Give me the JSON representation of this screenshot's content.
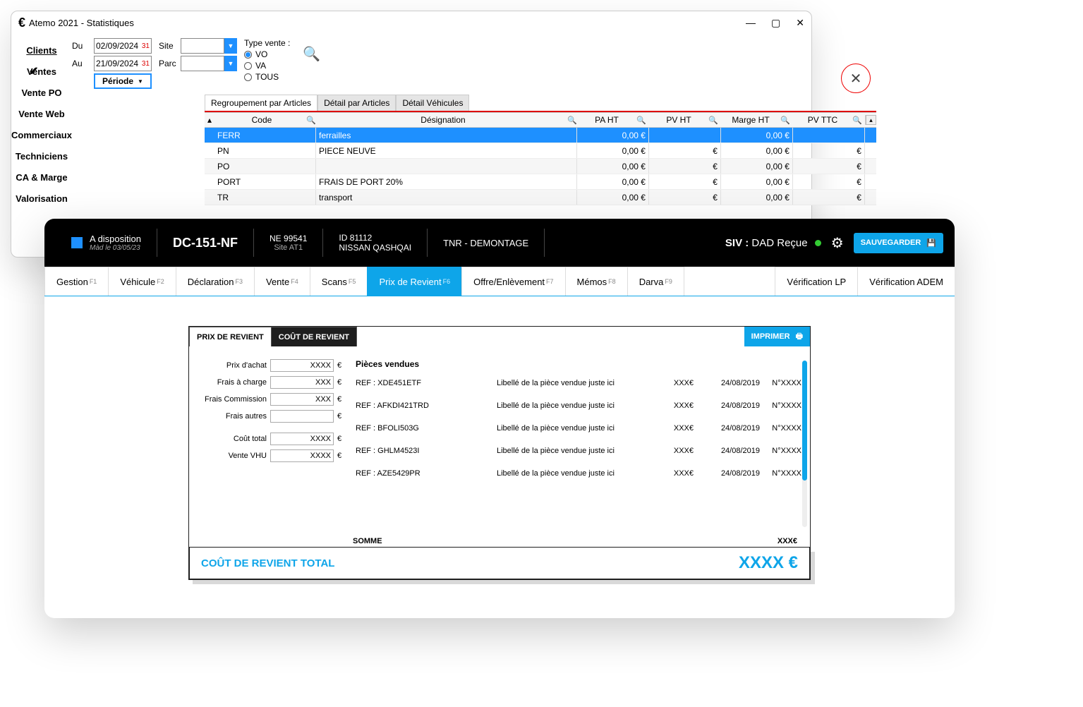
{
  "win1": {
    "title": "Atemo 2021 - Statistiques",
    "sidebar": [
      "Clients",
      "Ventes",
      "Vente PO",
      "Vente Web",
      "Commerciaux",
      "Techniciens",
      "CA & Marge",
      "Valorisation"
    ],
    "filters": {
      "du_label": "Du",
      "du_value": "02/09/2024",
      "au_label": "Au",
      "au_value": "21/09/2024",
      "period_label": "Période",
      "site_label": "Site",
      "parc_label": "Parc",
      "type_vente_label": "Type vente :",
      "radios": [
        "VO",
        "VA",
        "TOUS"
      ]
    },
    "tabs": [
      "Regroupement par Articles",
      "Détail par Articles",
      "Détail Véhicules"
    ],
    "columns": [
      "Code",
      "Désignation",
      "PA HT",
      "PV HT",
      "Marge HT",
      "PV TTC"
    ],
    "rows": [
      {
        "code": "FERR",
        "des": "ferrailles",
        "pa": "0,00 €",
        "pv": "",
        "marge": "0,00 €",
        "ttc": ""
      },
      {
        "code": "PN",
        "des": "PIECE NEUVE",
        "pa": "0,00 €",
        "pv": "€",
        "marge": "0,00 €",
        "ttc": "€"
      },
      {
        "code": "PO",
        "des": "",
        "pa": "0,00 €",
        "pv": "€",
        "marge": "0,00 €",
        "ttc": "€"
      },
      {
        "code": "PORT",
        "des": "FRAIS DE PORT 20%",
        "pa": "0,00 €",
        "pv": "€",
        "marge": "0,00 €",
        "ttc": "€"
      },
      {
        "code": "TR",
        "des": "transport",
        "pa": "0,00 €",
        "pv": "€",
        "marge": "0,00 €",
        "ttc": "€"
      }
    ]
  },
  "win2": {
    "status": {
      "title": "A disposition",
      "sub": "Màd le 03/05/23"
    },
    "plate": "DC-151-NF",
    "info1": {
      "top": "NE 99541",
      "bot": "Site AT1"
    },
    "info2": {
      "top": "ID 81112",
      "bot": "NISSAN QASHQAI"
    },
    "info3": "TNR - DEMONTAGE",
    "siv_label": "SIV :",
    "siv_value": "DAD Reçue",
    "save_label": "SAUVEGARDER",
    "tabs": [
      {
        "label": "Gestion",
        "key": "F1"
      },
      {
        "label": "Véhicule",
        "key": "F2"
      },
      {
        "label": "Déclaration",
        "key": "F3"
      },
      {
        "label": "Vente",
        "key": "F4"
      },
      {
        "label": "Scans",
        "key": "F5"
      },
      {
        "label": "Prix de Revient",
        "key": "F6"
      },
      {
        "label": "Offre/Enlèvement",
        "key": "F7"
      },
      {
        "label": "Mémos",
        "key": "F8"
      },
      {
        "label": "Darva",
        "key": "F9"
      }
    ],
    "right_tabs": [
      "Vérification LP",
      "Vérification ADEM"
    ],
    "panel_tabs": [
      "PRIX DE REVIENT",
      "COÛT DE REVIENT"
    ],
    "imprimer": "IMPRIMER",
    "form": [
      {
        "label": "Prix d'achat",
        "value": "XXXX"
      },
      {
        "label": "Frais à charge",
        "value": "XXX"
      },
      {
        "label": "Frais Commission",
        "value": "XXX"
      },
      {
        "label": "Frais autres",
        "value": ""
      },
      {
        "label": "Coût total",
        "value": "XXXX"
      },
      {
        "label": "Vente VHU",
        "value": "XXXX"
      }
    ],
    "pieces_title": "Pièces vendues",
    "pieces": [
      {
        "ref": "REF : XDE451ETF",
        "lib": "Libellé de la pièce vendue juste ici",
        "price": "XXX€",
        "date": "24/08/2019",
        "num": "N°XXXX"
      },
      {
        "ref": "REF : AFKDI421TRD",
        "lib": "Libellé de la pièce vendue juste ici",
        "price": "XXX€",
        "date": "24/08/2019",
        "num": "N°XXXX"
      },
      {
        "ref": "REF : BFOLI503G",
        "lib": "Libellé de la pièce vendue juste ici",
        "price": "XXX€",
        "date": "24/08/2019",
        "num": "N°XXXX"
      },
      {
        "ref": "REF : GHLM4523I",
        "lib": "Libellé de la pièce vendue juste ici",
        "price": "XXX€",
        "date": "24/08/2019",
        "num": "N°XXXX"
      },
      {
        "ref": "REF : AZE5429PR",
        "lib": "Libellé de la pièce vendue juste ici",
        "price": "XXX€",
        "date": "24/08/2019",
        "num": "N°XXXX"
      }
    ],
    "somme_label": "SOMME",
    "somme_value": "XXX€",
    "total_label": "COÛT DE REVIENT TOTAL",
    "total_value": "XXXX €"
  }
}
